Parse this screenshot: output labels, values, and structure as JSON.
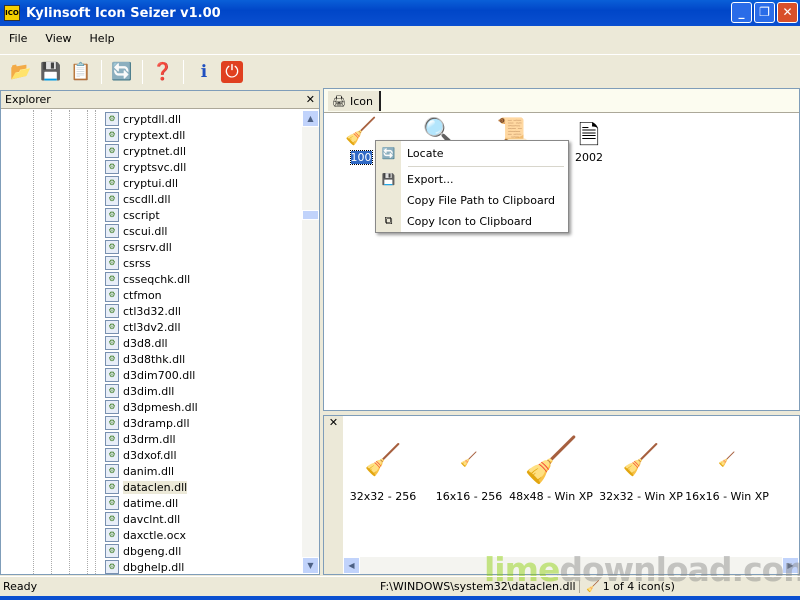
{
  "window": {
    "title": "Kylinsoft Icon Seizer v1.00",
    "minimize": "_",
    "maximize": "❐",
    "close": "✕"
  },
  "menu": [
    "File",
    "View",
    "Help"
  ],
  "toolbar": [
    {
      "name": "open-icon",
      "glyph": "📂"
    },
    {
      "name": "save-icon",
      "glyph": "💾"
    },
    {
      "name": "copy-icon",
      "glyph": "📋"
    },
    {
      "name": "locate-icon",
      "glyph": "🔄"
    },
    {
      "name": "help-icon",
      "glyph": "❓"
    },
    {
      "name": "info-icon",
      "glyph": "ℹ"
    },
    {
      "name": "power-icon",
      "glyph": "⏻"
    }
  ],
  "explorer": {
    "title": "Explorer",
    "close": "✕",
    "selected": "dataclen.dll",
    "items": [
      "cryptdll.dll",
      "cryptext.dll",
      "cryptnet.dll",
      "cryptsvc.dll",
      "cryptui.dll",
      "cscdll.dll",
      "cscript",
      "cscui.dll",
      "csrsrv.dll",
      "csrss",
      "csseqchk.dll",
      "ctfmon",
      "ctl3d32.dll",
      "ctl3dv2.dll",
      "d3d8.dll",
      "d3d8thk.dll",
      "d3dim700.dll",
      "d3dim.dll",
      "d3dpmesh.dll",
      "d3dramp.dll",
      "d3drm.dll",
      "d3dxof.dll",
      "danim.dll",
      "dataclen.dll",
      "datime.dll",
      "davclnt.dll",
      "daxctle.ocx",
      "dbgeng.dll",
      "dbghelp.dll"
    ]
  },
  "icon_tab": {
    "label": "Icon",
    "icons": [
      {
        "label": "100",
        "selected": true
      },
      {
        "label": ""
      },
      {
        "label": ""
      },
      {
        "label": "2002"
      }
    ]
  },
  "context_menu": {
    "items": [
      "Locate",
      "Export...",
      "Copy File Path to Clipboard",
      "Copy Icon to Clipboard"
    ]
  },
  "preview": {
    "close": "✕",
    "items": [
      "32x32 - 256",
      "16x16 - 256",
      "48x48 - Win XP",
      "32x32 - Win XP",
      "16x16 - Win XP"
    ]
  },
  "status": {
    "left": "Ready",
    "path": "F:\\WINDOWS\\system32\\dataclen.dll",
    "count": "1 of 4 icon(s)"
  },
  "watermark": "limedownload.com",
  "colors": {
    "titlebar": "#0046c8",
    "selection": "#316ac5",
    "face": "#ece9d8"
  }
}
